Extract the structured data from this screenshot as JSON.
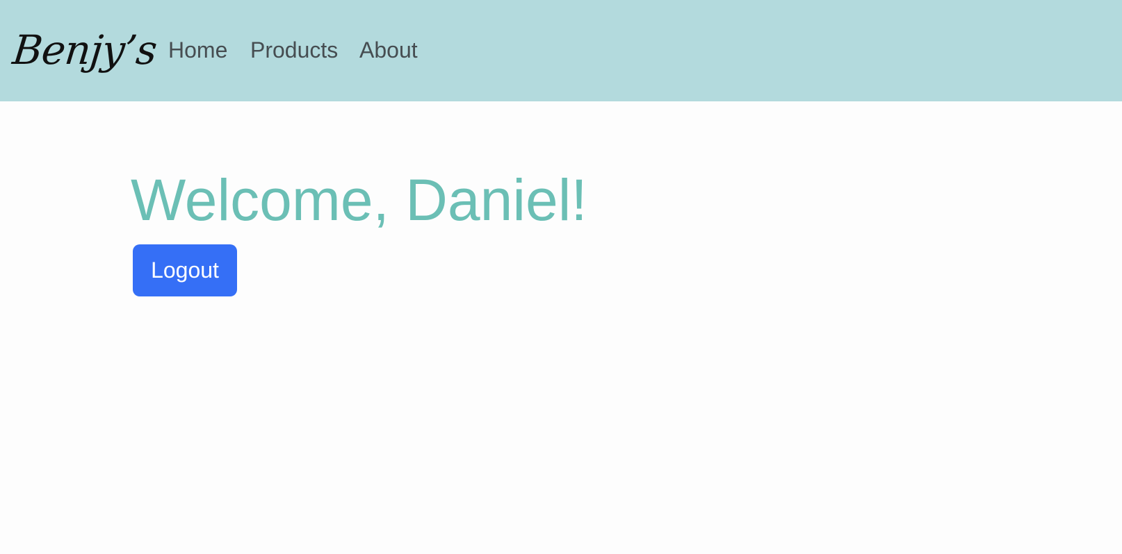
{
  "header": {
    "brand": "Benjy’s",
    "nav": {
      "home": "Home",
      "products": "Products",
      "about": "About"
    },
    "background_color": "#b3dadd"
  },
  "main": {
    "welcome": "Welcome, Daniel!",
    "logout_label": "Logout",
    "accent_color": "#6bbfb5",
    "button_color": "#356ff6"
  }
}
